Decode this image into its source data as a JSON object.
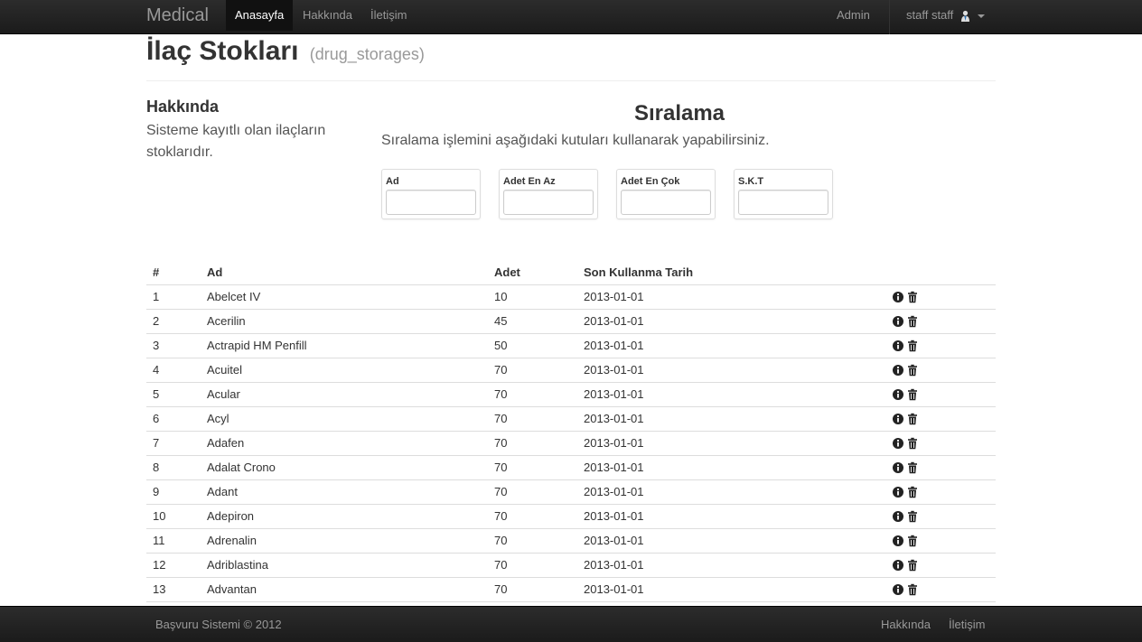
{
  "navbar": {
    "brand": "Medical",
    "links": [
      "Anasayfa",
      "Hakkında",
      "İletişim"
    ],
    "admin": "Admin",
    "user": "staff staff"
  },
  "page": {
    "title": "İlaç Stokları",
    "subtitle": "(drug_storages)"
  },
  "about": {
    "heading": "Hakkında",
    "text": "Sisteme kayıtlı olan ilaçların stoklarıdır."
  },
  "sorting": {
    "heading": "Sıralama",
    "description": "Sıralama işlemini aşağıdaki kutuları kullanarak yapabilirsiniz.",
    "filters": [
      "Ad",
      "Adet En Az",
      "Adet En Çok",
      "S.K.T"
    ]
  },
  "table": {
    "headers": [
      "#",
      "Ad",
      "Adet",
      "Son Kullanma Tarih"
    ],
    "rows": [
      [
        "1",
        "Abelcet IV",
        "10",
        "2013-01-01"
      ],
      [
        "2",
        "Acerilin",
        "45",
        "2013-01-01"
      ],
      [
        "3",
        "Actrapid HM Penfill",
        "50",
        "2013-01-01"
      ],
      [
        "4",
        "Acuitel",
        "70",
        "2013-01-01"
      ],
      [
        "5",
        "Acular",
        "70",
        "2013-01-01"
      ],
      [
        "6",
        "Acyl",
        "70",
        "2013-01-01"
      ],
      [
        "7",
        "Adafen",
        "70",
        "2013-01-01"
      ],
      [
        "8",
        "Adalat Crono",
        "70",
        "2013-01-01"
      ],
      [
        "9",
        "Adant",
        "70",
        "2013-01-01"
      ],
      [
        "10",
        "Adepiron",
        "70",
        "2013-01-01"
      ],
      [
        "11",
        "Adrenalin",
        "70",
        "2013-01-01"
      ],
      [
        "12",
        "Adriblastina",
        "70",
        "2013-01-01"
      ],
      [
        "13",
        "Advantan",
        "70",
        "2013-01-01"
      ],
      [
        "",
        "",
        "",
        ""
      ]
    ],
    "row_icons": [
      "info-icon",
      "trash-icon"
    ]
  },
  "footer": {
    "copyright": "Başvuru Sistemi © 2012",
    "links": [
      "Hakkında",
      "İletişim"
    ]
  },
  "colors": {
    "navbar": "#1b1b1b",
    "active_link_text": "#ffffff",
    "muted_text": "#999999"
  }
}
